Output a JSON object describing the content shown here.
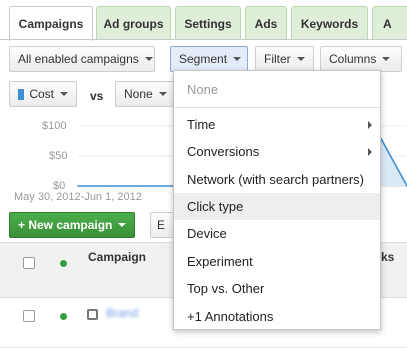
{
  "tabs": [
    "Campaigns",
    "Ad groups",
    "Settings",
    "Ads",
    "Keywords",
    "A"
  ],
  "toolbar": {
    "filter_scope": "All enabled campaigns",
    "segment": "Segment",
    "filter": "Filter",
    "columns": "Columns"
  },
  "compare": {
    "metric": "Cost",
    "vs": "vs",
    "metric2": "None"
  },
  "chart_data": {
    "type": "area",
    "y_ticks": [
      "$100",
      "$50",
      "$0"
    ],
    "ylim": [
      0,
      100
    ],
    "x": [
      "May 30",
      "",
      "",
      "",
      "",
      "",
      "",
      "",
      "",
      "",
      "Jun 1"
    ],
    "values": [
      0,
      0,
      0,
      0,
      38,
      40,
      38,
      97,
      30,
      100,
      0
    ],
    "color": "#3d8fd1",
    "date_range": "May 30, 2012-Jun 1, 2012"
  },
  "actions": {
    "new_campaign": "+ New campaign",
    "edit_cut": "E"
  },
  "table": {
    "headers": [
      "Campaign",
      "ks"
    ],
    "row_name": "Brand"
  },
  "segment_menu": {
    "items": [
      {
        "label": "None",
        "submenu": false
      },
      {
        "label": "Time",
        "submenu": true
      },
      {
        "label": "Conversions",
        "submenu": true
      },
      {
        "label": "Network (with search partners)",
        "submenu": false
      },
      {
        "label": "Click type",
        "submenu": false
      },
      {
        "label": "Device",
        "submenu": false
      },
      {
        "label": "Experiment",
        "submenu": false
      },
      {
        "label": "Top vs. Other",
        "submenu": false
      },
      {
        "label": "+1 Annotations",
        "submenu": false
      }
    ],
    "hovered": "Click type"
  }
}
